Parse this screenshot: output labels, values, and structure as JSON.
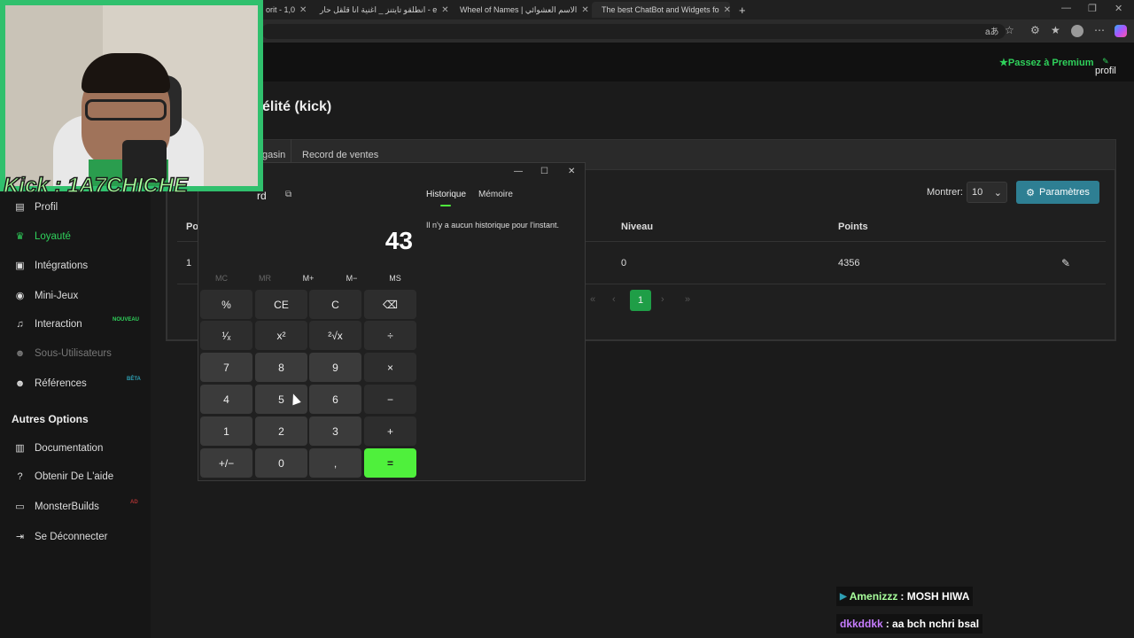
{
  "browser": {
    "tabs": [
      {
        "label": "orit - 1,0",
        "icon": "page-icon",
        "x": 0
      },
      {
        "label": "انطلقو تايتنز _ اغنية انا قلقل حار - e",
        "icon": "youtube-icon",
        "x": 0
      },
      {
        "label": "Wheel of Names | الاسم العشوائي",
        "icon": "wheel-icon",
        "x": 0
      },
      {
        "label": "The best ChatBot and Widgets fo",
        "icon": "botrix-icon",
        "x": 0
      }
    ],
    "new_tab": "+"
  },
  "site": {
    "premium": "Passez à Premium",
    "profil": "profil",
    "page_title": "élité (kick)",
    "tabs": [
      "gasin",
      "Record de ventes"
    ],
    "show_label": "Montrer:",
    "show_value": "10",
    "params_label": "Paramètres",
    "table": {
      "headers": [
        "Po",
        "Niveau",
        "Points"
      ],
      "row": [
        "1",
        "0",
        "4356"
      ]
    },
    "pagination": {
      "first": "«",
      "prev": "‹",
      "current": "1",
      "next": "›",
      "last": "»"
    }
  },
  "sidebar": {
    "items": [
      {
        "label": "Profil",
        "icon": "user-card-icon"
      },
      {
        "label": "Loyauté",
        "icon": "trophy-icon",
        "color": "#2fd15b"
      },
      {
        "label": "Intégrations",
        "icon": "integrations-icon"
      },
      {
        "label": "Mini-Jeux",
        "icon": "gamepad-icon"
      },
      {
        "label": "Interaction",
        "icon": "music-icon",
        "badge": "NOUVEAU"
      },
      {
        "label": "Sous-Utilisateurs",
        "icon": "users-icon",
        "disabled": true
      },
      {
        "label": "Références",
        "icon": "users-icon",
        "badge": "BÊTA"
      },
      {
        "label": "Documentation",
        "icon": "book-icon"
      },
      {
        "label": "Obtenir De L'aide",
        "icon": "help-icon"
      },
      {
        "label": "MonsterBuilds",
        "icon": "laptop-icon",
        "badge": "AD"
      },
      {
        "label": "Se Déconnecter",
        "icon": "logout-icon"
      }
    ],
    "section_title": "Autres Options"
  },
  "webcam": {
    "overlay_text": "Kick : 1A7CHICHE"
  },
  "calculator": {
    "mode": "rd",
    "display": "43",
    "memory": [
      "MC",
      "MR",
      "M+",
      "M−",
      "MS"
    ],
    "keys": [
      [
        "%",
        "CE",
        "C",
        "⌫"
      ],
      [
        "¹⁄ₓ",
        "x²",
        "²√x",
        "÷"
      ],
      [
        "7",
        "8",
        "9",
        "×"
      ],
      [
        "4",
        "5",
        "6",
        "−"
      ],
      [
        "1",
        "2",
        "3",
        "+"
      ],
      [
        "+/−",
        "0",
        ",",
        "="
      ]
    ],
    "history_tab": "Historique",
    "memory_tab": "Mémoire",
    "history_empty": "Il n'y a aucun historique pour l'instant.",
    "win_controls": [
      "—",
      "☐",
      "✕"
    ]
  },
  "chat": [
    {
      "user": "Amenizzz",
      "message": ": MOSH HIWA",
      "color": "#a8ff9c"
    },
    {
      "user": "dkkddkk",
      "message": ": aa bch nchri bsal",
      "color": "#c77dff"
    }
  ],
  "colors": {
    "accent": "#2fd15b",
    "calc_equals": "#4ff03c",
    "params_button": "#2e7f93"
  }
}
